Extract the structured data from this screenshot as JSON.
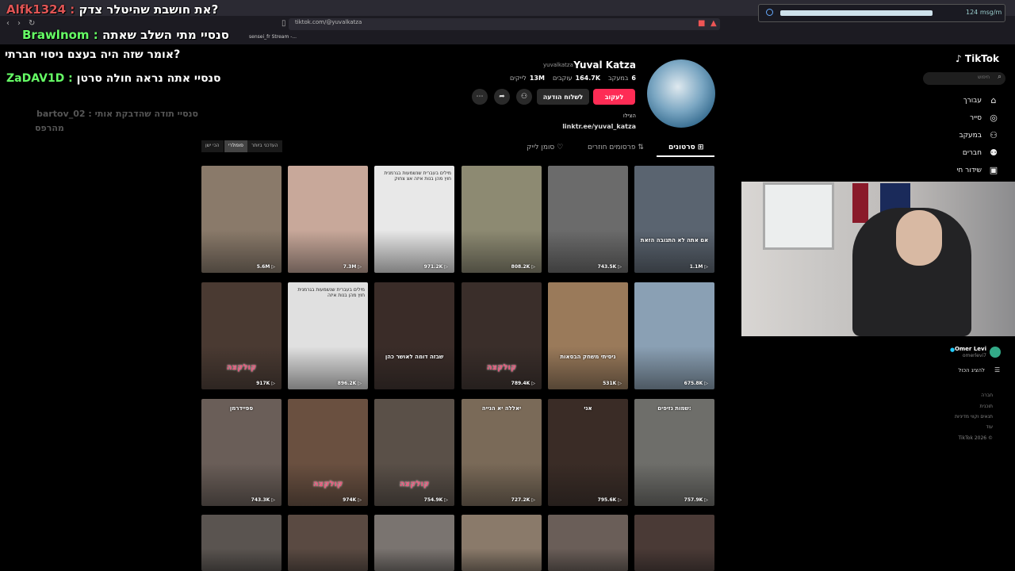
{
  "browser": {
    "url": "tiktok.com/@yuvalkatza",
    "bookmarks": [
      "sensei_fr Stream -..."
    ],
    "system_monitor": {
      "value": "124 msg/m",
      "level": 0.85
    }
  },
  "chat_messages": [
    {
      "user": "Alfk1324",
      "text": "את חושבת שהיטלר צדק?",
      "user_color": "#e05555"
    },
    {
      "user": "Brawlnom",
      "text": "סנסיי מתי השלב שאתה",
      "user_color": "#6f6"
    },
    {
      "user": "",
      "text": "אומר שזה היה בעצם ניסוי חברתי?",
      "user_color": "#6f6"
    },
    {
      "user": "ZaDAV1D",
      "text": "סנסיי אתה נראה חולה סרטן",
      "user_color": "#6f6"
    },
    {
      "user": "bartov_02",
      "text": "סנסיי תודה שהדבקת אותי",
      "user_color": "#555"
    },
    {
      "user": "",
      "text": "מהרפס",
      "user_color": "#555"
    }
  ],
  "sidebar": {
    "logo": "TikTok",
    "search_placeholder": "חיפוש",
    "items": [
      {
        "label": "עבורך",
        "icon": "home-icon"
      },
      {
        "label": "סייר",
        "icon": "compass-icon"
      },
      {
        "label": "במעקב",
        "icon": "following-icon"
      },
      {
        "label": "חברים",
        "icon": "friends-icon"
      },
      {
        "label": "שידור חי",
        "icon": "live-icon"
      }
    ],
    "following_account": {
      "name": "Omer Levi",
      "handle": "omerlevi7"
    },
    "see_all": "להציג הכול",
    "footer": [
      "חברה",
      "תוכנית",
      "תנאים וקווי מדיניות",
      "עוד",
      "TikTok 2026 ©"
    ]
  },
  "profile": {
    "display_name": "Yuval Katza",
    "username": "yuvalkatza",
    "following_count": "6",
    "following_label": "במעקב",
    "followers_count": "164.7K",
    "followers_label": "עוקבים",
    "likes_count": "13M",
    "likes_label": "לייקים",
    "follow_button": "לעקוב",
    "message_button": "לשלוח הודעה",
    "bio": "הצילו",
    "link": "linktr.ee/yuval_katza"
  },
  "tabs": [
    {
      "label": "סרטונים",
      "active": true
    },
    {
      "label": "פרסומים חוזרים",
      "active": false
    },
    {
      "label": "סומן לייק",
      "active": false
    }
  ],
  "sort_options": [
    {
      "label": "העדכני ביותר",
      "active": false
    },
    {
      "label": "פופולרי",
      "active": true
    },
    {
      "label": "הכי ישן",
      "active": false
    }
  ],
  "videos": [
    {
      "views": "1.1M",
      "caption": "אם אתה לא התגובה הזאת",
      "color": "#5a6470"
    },
    {
      "views": "743.5K",
      "caption": "",
      "color": "#6b6b6b"
    },
    {
      "views": "808.2K",
      "caption": "",
      "color": "#8d8a72"
    },
    {
      "views": "971.2K",
      "caption": "מילים בעברית שנשמעות בגרמנית חוץ מהן בנות איזה אצ צחוק",
      "color": "#e8e8e8"
    },
    {
      "views": "7.3M",
      "caption": "",
      "color": "#c8a89a"
    },
    {
      "views": "5.6M",
      "caption": "",
      "color": "#8a7a6a"
    },
    {
      "views": "675.8K",
      "caption": "",
      "color": "#8aa0b4"
    },
    {
      "views": "531K",
      "caption": "ניסיתי משחק הבסאות",
      "color": "#9a7a5a"
    },
    {
      "views": "789.4K",
      "caption": "",
      "overlay": "קולקצה",
      "color": "#3a2e2a"
    },
    {
      "views": "",
      "caption": "שבזה דומה לאושר כהן",
      "color": "#3a2c28"
    },
    {
      "views": "896.2K",
      "caption": "מילים בעברית שנשמעות בגרמנית חוץ מהן בנות איזה",
      "color": "#e0e0e0"
    },
    {
      "views": "917K",
      "caption": "",
      "overlay": "קולקצה",
      "color": "#4a3a32"
    },
    {
      "views": "757.9K",
      "caption": "שמות נזיפים:",
      "color": "#6e6e6a"
    },
    {
      "views": "795.6K",
      "caption": "אני",
      "color": "#3a2c26"
    },
    {
      "views": "727.2K",
      "caption": "יאללה יא הנייה",
      "color": "#7a6a58"
    },
    {
      "views": "754.9K",
      "caption": "",
      "overlay": "קולקצה",
      "color": "#5a5048"
    },
    {
      "views": "974K",
      "caption": "",
      "overlay": "קולקצה",
      "color": "#6a5040"
    },
    {
      "views": "743.3K",
      "caption": "ספיידרמן",
      "color": "#6a5e58"
    },
    {
      "views": "",
      "caption": "",
      "color": "#4a3a36"
    },
    {
      "views": "",
      "caption": "",
      "color": "#6a5e58"
    },
    {
      "views": "",
      "caption": "",
      "color": "#8a7a6a"
    },
    {
      "views": "",
      "caption": "",
      "color": "#7a7470"
    },
    {
      "views": "",
      "caption": "",
      "color": "#5a4a42"
    },
    {
      "views": "",
      "caption": "",
      "color": "#5a5450"
    }
  ],
  "colors": {
    "accent": "#fe2c55",
    "background": "#000000"
  }
}
